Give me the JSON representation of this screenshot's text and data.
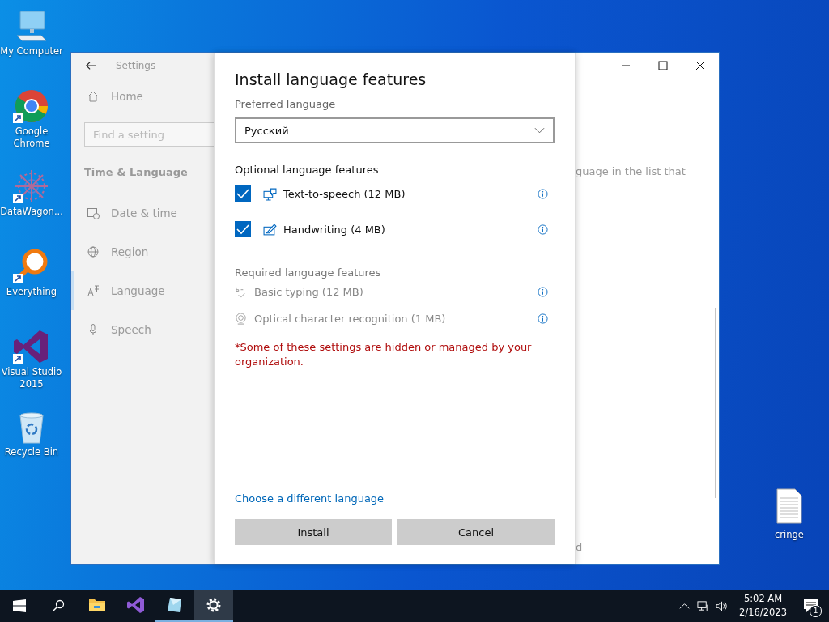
{
  "desktop_icons": [
    {
      "label": "My Computer",
      "kind": "computer",
      "shortcut": false
    },
    {
      "label": "Google Chrome",
      "kind": "chrome",
      "shortcut": true
    },
    {
      "label": "DataWagon...",
      "kind": "datawagon",
      "shortcut": true
    },
    {
      "label": "Everything",
      "kind": "everything",
      "shortcut": true
    },
    {
      "label": "Visual Studio 2015",
      "kind": "vs",
      "shortcut": true
    },
    {
      "label": "Recycle Bin",
      "kind": "recycle",
      "shortcut": false
    }
  ],
  "desktop_file": {
    "label": "cringe"
  },
  "window": {
    "title": "Settings",
    "sidebar": {
      "home": "Home",
      "search_placeholder": "Find a setting",
      "section": "Time & Language",
      "items": [
        {
          "label": "Date & time",
          "kind": "calendar",
          "selected": false
        },
        {
          "label": "Region",
          "kind": "globe",
          "selected": false
        },
        {
          "label": "Language",
          "kind": "language",
          "selected": true
        },
        {
          "label": "Speech",
          "kind": "mic",
          "selected": false
        }
      ]
    },
    "background_text": [
      "guage in the list that",
      "d"
    ]
  },
  "dialog": {
    "title": "Install language features",
    "preferred_label": "Preferred language",
    "preferred_value": "Русский",
    "optional_heading": "Optional language features",
    "optional_features": [
      {
        "label": "Text-to-speech (12 MB)",
        "kind": "speech",
        "checked": true
      },
      {
        "label": "Handwriting (4 MB)",
        "kind": "pen",
        "checked": true
      }
    ],
    "required_heading": "Required language features",
    "required_features": [
      {
        "label": "Basic typing (12 MB)",
        "kind": "typing"
      },
      {
        "label": "Optical character recognition (1 MB)",
        "kind": "ocr"
      }
    ],
    "note": "*Some of these settings are hidden or managed by your organization.",
    "link": "Choose a different language",
    "buttons": [
      "Install",
      "Cancel"
    ]
  },
  "taskbar": {
    "apps": [
      {
        "kind": "explorer",
        "running": false,
        "active": false
      },
      {
        "kind": "vs",
        "running": false,
        "active": false
      },
      {
        "kind": "glass",
        "running": true,
        "active": false
      },
      {
        "kind": "settings",
        "running": true,
        "active": true
      }
    ],
    "time": "5:02 AM",
    "date": "2/16/2023",
    "notifications": "1"
  }
}
